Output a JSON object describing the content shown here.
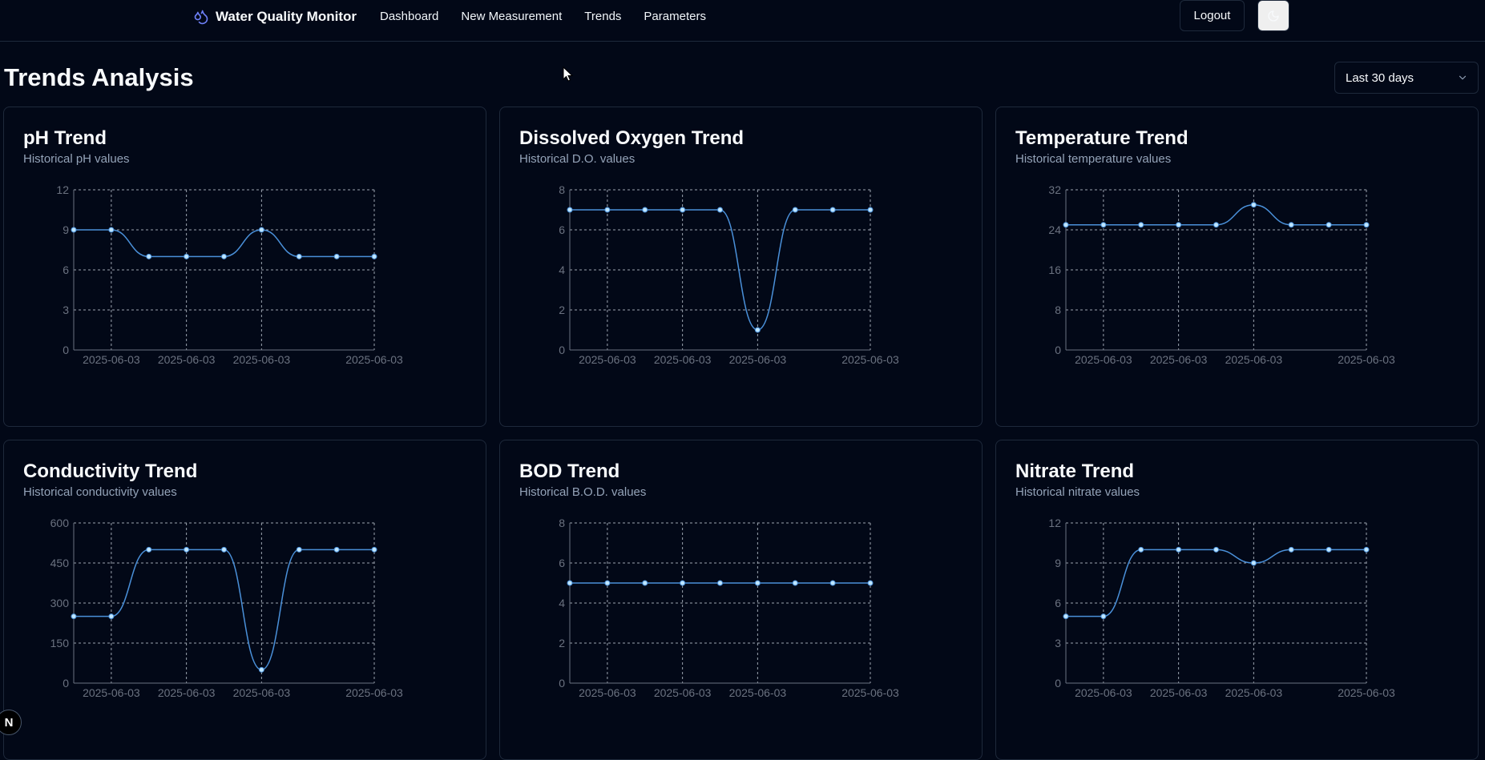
{
  "app": {
    "name": "Water Quality Monitor",
    "nav": [
      "Dashboard",
      "New Measurement",
      "Trends",
      "Parameters"
    ],
    "logout_label": "Logout",
    "icons": {
      "brand": "droplets-icon",
      "theme": "moon-icon",
      "select": "chevron-down-icon"
    }
  },
  "page": {
    "title": "Trends Analysis",
    "range_selected": "Last 30 days"
  },
  "colors": {
    "line": "#4a90d9",
    "point": "#bfe6ff",
    "grid": "#9ca3af",
    "axis": "#6b7280"
  },
  "chart_data": [
    {
      "type": "line",
      "title": "pH Trend",
      "subtitle": "Historical pH values",
      "x": [
        "2025-06-03",
        "2025-06-03",
        "2025-06-03",
        "2025-06-03",
        "2025-06-03",
        "2025-06-03",
        "2025-06-03",
        "2025-06-03",
        "2025-06-03"
      ],
      "x_tick_labels": [
        "2025-06-03",
        "2025-06-03",
        "2025-06-03",
        "2025-06-03"
      ],
      "values": [
        9,
        9,
        7,
        7,
        7,
        9,
        7,
        7,
        7
      ],
      "yticks": [
        0,
        3,
        6,
        9,
        12
      ],
      "ylim": [
        0,
        12
      ]
    },
    {
      "type": "line",
      "title": "Dissolved Oxygen Trend",
      "subtitle": "Historical D.O. values",
      "x": [
        "2025-06-03",
        "2025-06-03",
        "2025-06-03",
        "2025-06-03",
        "2025-06-03",
        "2025-06-03",
        "2025-06-03",
        "2025-06-03",
        "2025-06-03"
      ],
      "x_tick_labels": [
        "2025-06-03",
        "2025-06-03",
        "2025-06-03",
        "2025-06-03"
      ],
      "values": [
        7,
        7,
        7,
        7,
        7,
        1,
        7,
        7,
        7
      ],
      "yticks": [
        0,
        2,
        4,
        6,
        8
      ],
      "ylim": [
        0,
        8
      ]
    },
    {
      "type": "line",
      "title": "Temperature Trend",
      "subtitle": "Historical temperature values",
      "x": [
        "2025-06-03",
        "2025-06-03",
        "2025-06-03",
        "2025-06-03",
        "2025-06-03",
        "2025-06-03",
        "2025-06-03",
        "2025-06-03",
        "2025-06-03"
      ],
      "x_tick_labels": [
        "2025-06-03",
        "2025-06-03",
        "2025-06-03",
        "2025-06-03"
      ],
      "values": [
        25,
        25,
        25,
        25,
        25,
        29,
        25,
        25,
        25
      ],
      "yticks": [
        0,
        8,
        16,
        24,
        32
      ],
      "ylim": [
        0,
        32
      ]
    },
    {
      "type": "line",
      "title": "Conductivity Trend",
      "subtitle": "Historical conductivity values",
      "x": [
        "2025-06-03",
        "2025-06-03",
        "2025-06-03",
        "2025-06-03",
        "2025-06-03",
        "2025-06-03",
        "2025-06-03",
        "2025-06-03",
        "2025-06-03"
      ],
      "x_tick_labels": [
        "2025-06-03",
        "2025-06-03",
        "2025-06-03",
        "2025-06-03"
      ],
      "values": [
        250,
        250,
        500,
        500,
        500,
        50,
        500,
        500,
        500
      ],
      "yticks": [
        0,
        150,
        300,
        450,
        600
      ],
      "ylim": [
        0,
        600
      ]
    },
    {
      "type": "line",
      "title": "BOD Trend",
      "subtitle": "Historical B.O.D. values",
      "x": [
        "2025-06-03",
        "2025-06-03",
        "2025-06-03",
        "2025-06-03",
        "2025-06-03",
        "2025-06-03",
        "2025-06-03",
        "2025-06-03",
        "2025-06-03"
      ],
      "x_tick_labels": [
        "2025-06-03",
        "2025-06-03",
        "2025-06-03",
        "2025-06-03"
      ],
      "values": [
        5,
        5,
        5,
        5,
        5,
        5,
        5,
        5,
        5
      ],
      "yticks": [
        0,
        2,
        4,
        6,
        8
      ],
      "ylim": [
        0,
        8
      ]
    },
    {
      "type": "line",
      "title": "Nitrate Trend",
      "subtitle": "Historical nitrate values",
      "x": [
        "2025-06-03",
        "2025-06-03",
        "2025-06-03",
        "2025-06-03",
        "2025-06-03",
        "2025-06-03",
        "2025-06-03",
        "2025-06-03",
        "2025-06-03"
      ],
      "x_tick_labels": [
        "2025-06-03",
        "2025-06-03",
        "2025-06-03",
        "2025-06-03"
      ],
      "values": [
        5,
        5,
        10,
        10,
        10,
        9,
        10,
        10,
        10
      ],
      "yticks": [
        0,
        3,
        6,
        9,
        12
      ],
      "ylim": [
        0,
        12
      ]
    }
  ],
  "badge_letter": "N"
}
